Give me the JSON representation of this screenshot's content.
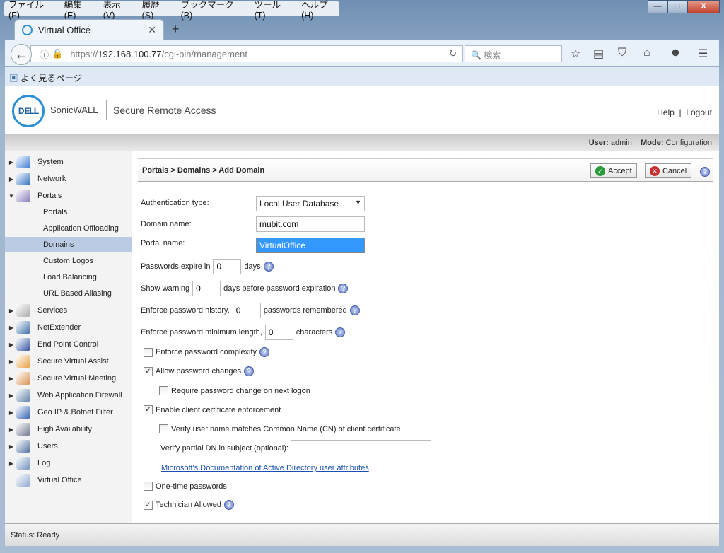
{
  "browser": {
    "menu": [
      "ファイル(F)",
      "編集(E)",
      "表示(V)",
      "履歴(S)",
      "ブックマーク(B)",
      "ツール(T)",
      "ヘルプ(H)"
    ],
    "tab_title": "Virtual Office",
    "url_scheme": "https://",
    "url_host": "192.168.100.77",
    "url_path": "/cgi-bin/management",
    "search_placeholder": "検索",
    "bookmark": "よく見るページ"
  },
  "header": {
    "logo": "DELL",
    "brand": "SonicWALL",
    "product": "Secure Remote Access",
    "help": "Help",
    "sep": "|",
    "logout": "Logout",
    "user_label": "User:",
    "user": "admin",
    "mode_label": "Mode:",
    "mode": "Configuration"
  },
  "sidebar": {
    "items": [
      {
        "label": "System",
        "type": "top",
        "icon": "monitor-icon",
        "color": "#3a7bd5"
      },
      {
        "label": "Network",
        "type": "top",
        "icon": "globe-icon",
        "color": "#2f6fc0"
      },
      {
        "label": "Portals",
        "type": "open",
        "icon": "house-icon",
        "color": "#8a7ab8"
      },
      {
        "label": "Portals",
        "type": "sub"
      },
      {
        "label": "Application Offloading",
        "type": "sub"
      },
      {
        "label": "Domains",
        "type": "sub",
        "selected": true
      },
      {
        "label": "Custom Logos",
        "type": "sub"
      },
      {
        "label": "Load Balancing",
        "type": "sub"
      },
      {
        "label": "URL Based Aliasing",
        "type": "sub"
      },
      {
        "label": "Services",
        "type": "top",
        "icon": "gears-icon",
        "color": "#aaaaaa"
      },
      {
        "label": "NetExtender",
        "type": "top",
        "icon": "netextender-icon",
        "color": "#3b6ea8"
      },
      {
        "label": "End Point Control",
        "type": "top",
        "icon": "shield-icon",
        "color": "#2d4fa0"
      },
      {
        "label": "Secure Virtual Assist",
        "type": "top",
        "icon": "support-agent-icon",
        "color": "#e8a040"
      },
      {
        "label": "Secure Virtual Meeting",
        "type": "top",
        "icon": "meeting-icon",
        "color": "#d89050"
      },
      {
        "label": "Web Application Firewall",
        "type": "top",
        "icon": "firewall-icon",
        "color": "#6080a8"
      },
      {
        "label": "Geo IP & Botnet Filter",
        "type": "top",
        "icon": "geo-icon",
        "color": "#3060b0"
      },
      {
        "label": "High Availability",
        "type": "top",
        "icon": "servers-icon",
        "color": "#707890"
      },
      {
        "label": "Users",
        "type": "top",
        "icon": "users-icon",
        "color": "#5070a0"
      },
      {
        "label": "Log",
        "type": "top",
        "icon": "log-icon",
        "color": "#7090c0"
      },
      {
        "label": "Virtual Office",
        "type": "leaf",
        "icon": "building-icon",
        "color": "#90a8d0"
      }
    ]
  },
  "content": {
    "breadcrumb": "Portals > Domains > Add Domain",
    "accept": "Accept",
    "cancel": "Cancel",
    "auth_label": "Authentication type:",
    "auth_value": "Local User Database",
    "domain_label": "Domain name:",
    "domain_value": "mubit.com",
    "portal_label": "Portal name:",
    "portal_value": "VirtualOffice",
    "expire_pre": "Passwords expire in",
    "expire_val": "0",
    "expire_post": "days",
    "warn_pre": "Show warning",
    "warn_val": "0",
    "warn_post": "days before password expiration",
    "hist_pre": "Enforce password history,",
    "hist_val": "0",
    "hist_post": "passwords remembered",
    "minlen_pre": "Enforce password minimum length,",
    "minlen_val": "0",
    "minlen_post": "characters",
    "complexity": {
      "label": "Enforce password complexity",
      "checked": false
    },
    "allow_change": {
      "label": "Allow password changes",
      "checked": true
    },
    "require_change": {
      "label": "Require password change on next logon",
      "checked": false
    },
    "client_cert": {
      "label": "Enable client certificate enforcement",
      "checked": true
    },
    "verify_cn": {
      "label": "Verify user name matches Common Name (CN) of client certificate",
      "checked": false
    },
    "partial_dn_label": "Verify partial DN in subject (optional):",
    "partial_dn_value": "",
    "ms_link": "Microsoft's Documentation of Active Directory user attributes",
    "otp": {
      "label": "One-time passwords",
      "checked": false
    },
    "technician": {
      "label": "Technician Allowed",
      "checked": true
    }
  },
  "status": "Status: Ready"
}
